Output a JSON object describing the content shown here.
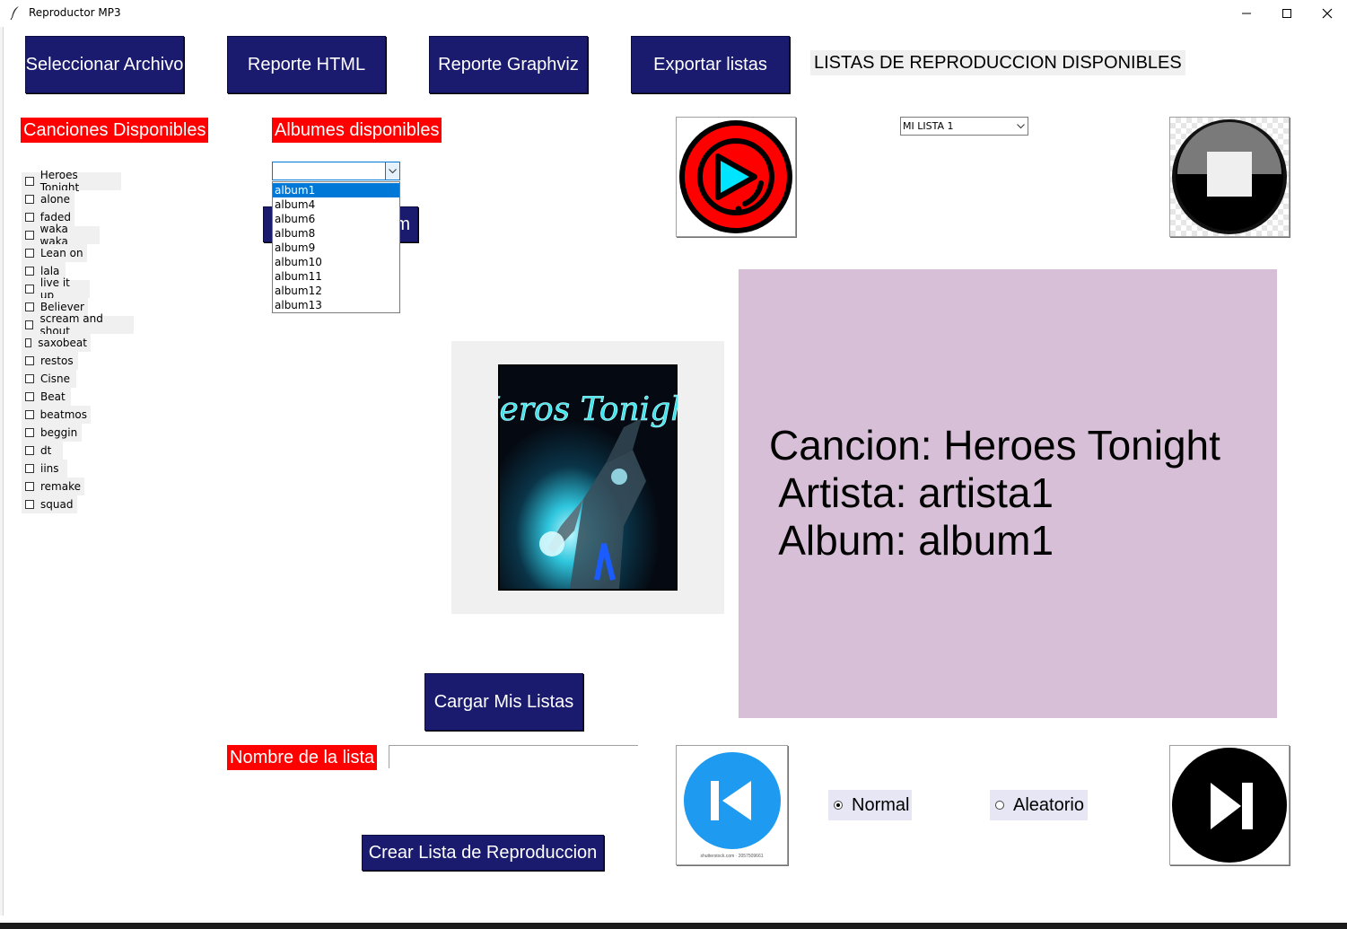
{
  "window": {
    "title": "Reproductor MP3"
  },
  "toolbar": {
    "select_file": "Seleccionar Archivo",
    "report_html": "Reporte HTML",
    "report_graphviz": "Reporte Graphviz",
    "export_lists": "Exportar listas",
    "available_lists_label": "LISTAS DE REPRODUCCION DISPONIBLES"
  },
  "songs": {
    "label": "Canciones Disponibles",
    "items": [
      "Heroes Tonight",
      "alone",
      "faded",
      "waka waka",
      "Lean on",
      "lala",
      "live it up",
      "Believer",
      "scream and shout",
      "saxobeat",
      "restos",
      "Cisne",
      "Beat",
      "beatmos",
      "beggin",
      "dt",
      "iins",
      "remake",
      "squad"
    ]
  },
  "albums": {
    "label": "Albumes disponibles",
    "combo_value": "",
    "options": [
      "album1",
      "album4",
      "album6",
      "album8",
      "album9",
      "album10",
      "album11",
      "album12",
      "album13"
    ],
    "selected_index": 0,
    "hidden_button_visible_text": "m"
  },
  "playlist_select": {
    "value": "MI LISTA 1"
  },
  "now_playing": {
    "song_line": "Cancion: Heroes Tonight",
    "artist_line": " Artista: artista1",
    "album_line": " Album: album1",
    "cover_title": "Heros Tonight"
  },
  "actions": {
    "load_lists": "Cargar Mis Listas",
    "list_name_label": "Nombre de la lista",
    "list_name_value": "",
    "create_list": "Crear Lista de Reproduccion"
  },
  "mode": {
    "normal": "Normal",
    "random": "Aleatorio",
    "selected": "normal"
  },
  "icons": {
    "play": "play-icon",
    "stop": "stop-icon",
    "previous": "previous-track-icon",
    "next": "next-track-icon",
    "prev_caption": "shutterstock.com · 2057509661"
  },
  "colors": {
    "navy": "#1a1a6e",
    "label_red": "#ff0000",
    "info_panel": "#d8bfd8",
    "play_red": "#ff0000",
    "play_cyan": "#00e5ff",
    "prev_blue": "#1e9bf0",
    "dropdown_select": "#0078d7"
  }
}
